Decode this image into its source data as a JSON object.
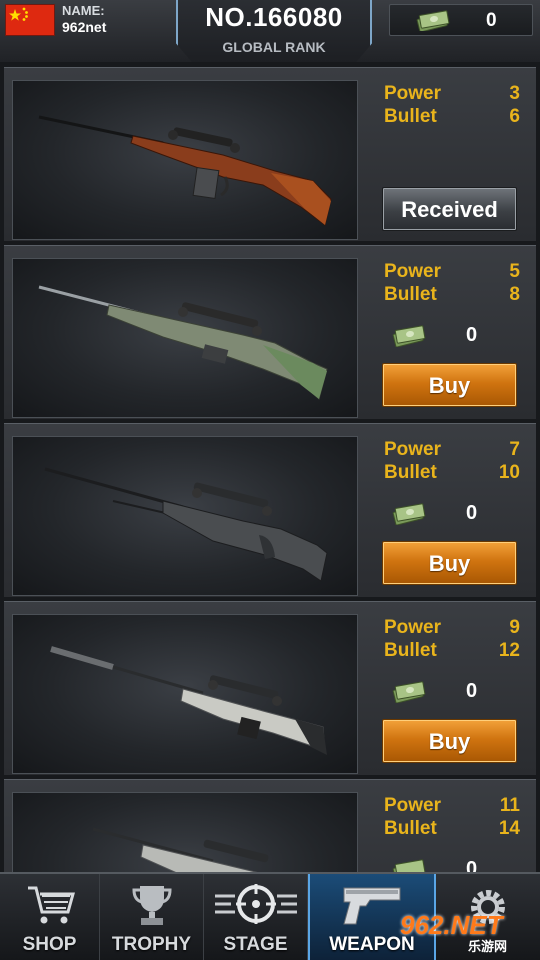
{
  "header": {
    "name_label": "NAME:",
    "player_name": "962net",
    "rank_number": "NO.166080",
    "rank_label": "GLOBAL RANK",
    "money": "0",
    "flag_icon": "china-flag-icon"
  },
  "weapons": [
    {
      "power_label": "Power",
      "power": "3",
      "bullet_label": "Bullet",
      "bullet": "6",
      "price": "",
      "button": "Received",
      "state": "received"
    },
    {
      "power_label": "Power",
      "power": "5",
      "bullet_label": "Bullet",
      "bullet": "8",
      "price": "0",
      "button": "Buy",
      "state": "buy"
    },
    {
      "power_label": "Power",
      "power": "7",
      "bullet_label": "Bullet",
      "bullet": "10",
      "price": "0",
      "button": "Buy",
      "state": "buy"
    },
    {
      "power_label": "Power",
      "power": "9",
      "bullet_label": "Bullet",
      "bullet": "12",
      "price": "0",
      "button": "Buy",
      "state": "buy"
    },
    {
      "power_label": "Power",
      "power": "11",
      "bullet_label": "Bullet",
      "bullet": "14",
      "price": "0",
      "button": "",
      "state": "buy"
    }
  ],
  "nav": {
    "shop": "SHOP",
    "trophy": "TROPHY",
    "stage": "STAGE",
    "weapon": "WEAPON",
    "active": "weapon"
  },
  "watermark": {
    "logo": "962.NET",
    "sub": "乐游网"
  },
  "colors": {
    "stat_gold": "#e9b41c",
    "buy_orange": "#d07410",
    "nav_active": "#1b4c78"
  }
}
